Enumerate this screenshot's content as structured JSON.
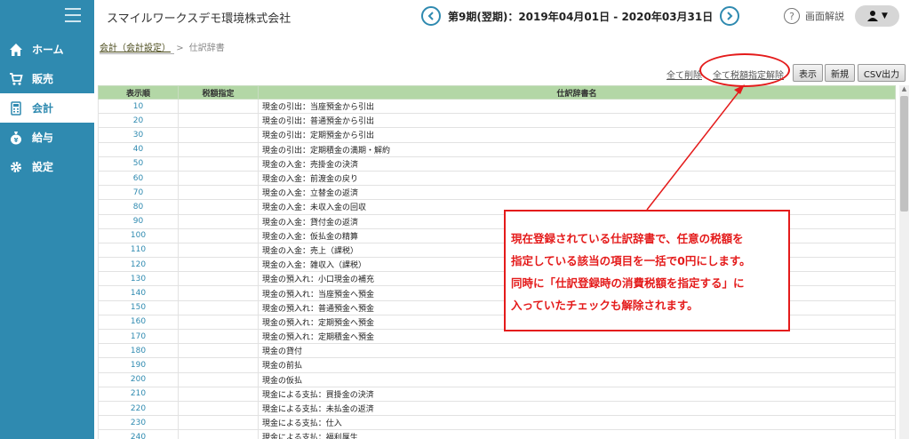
{
  "header": {
    "company": "スマイルワークスデモ環境株式会社",
    "period": "第9期(翌期)：2019年04月01日 - 2020年03月31日",
    "help_label": "画面解説"
  },
  "sidebar": {
    "items": [
      {
        "label": "ホーム",
        "icon": "home-icon"
      },
      {
        "label": "販売",
        "icon": "cart-icon"
      },
      {
        "label": "会計",
        "icon": "calculator-icon"
      },
      {
        "label": "給与",
        "icon": "money-bag-icon"
      },
      {
        "label": "設定",
        "icon": "gear-icon"
      }
    ],
    "active": "会計"
  },
  "breadcrumb": {
    "parent": "会計（会計設定）",
    "separator": ">",
    "current": "仕訳辞書"
  },
  "toolbar": {
    "delete_all": "全て削除",
    "clear_tax": "全て税額指定解除",
    "display": "表示",
    "new": "新規",
    "csv": "CSV出力"
  },
  "table": {
    "headers": [
      "表示順",
      "税額指定",
      "仕訳辞書名"
    ],
    "rows": [
      {
        "order": "10",
        "name": "現金の引出：当座預金から引出"
      },
      {
        "order": "20",
        "name": "現金の引出：普通預金から引出"
      },
      {
        "order": "30",
        "name": "現金の引出：定期預金から引出"
      },
      {
        "order": "40",
        "name": "現金の引出：定期積金の満期・解約"
      },
      {
        "order": "50",
        "name": "現金の入金：売掛金の決済"
      },
      {
        "order": "60",
        "name": "現金の入金：前渡金の戻り"
      },
      {
        "order": "70",
        "name": "現金の入金：立替金の返済"
      },
      {
        "order": "80",
        "name": "現金の入金：未収入金の回収"
      },
      {
        "order": "90",
        "name": "現金の入金：貸付金の返済"
      },
      {
        "order": "100",
        "name": "現金の入金：仮払金の精算"
      },
      {
        "order": "110",
        "name": "現金の入金：売上（課税）"
      },
      {
        "order": "120",
        "name": "現金の入金：雑収入（課税）"
      },
      {
        "order": "130",
        "name": "現金の預入れ：小口現金の補充"
      },
      {
        "order": "140",
        "name": "現金の預入れ：当座預金へ預金"
      },
      {
        "order": "150",
        "name": "現金の預入れ：普通預金へ預金"
      },
      {
        "order": "160",
        "name": "現金の預入れ：定期預金へ預金"
      },
      {
        "order": "170",
        "name": "現金の預入れ：定期積金へ預金"
      },
      {
        "order": "180",
        "name": "現金の貸付"
      },
      {
        "order": "190",
        "name": "現金の前払"
      },
      {
        "order": "200",
        "name": "現金の仮払"
      },
      {
        "order": "210",
        "name": "現金による支払：買掛金の決済"
      },
      {
        "order": "220",
        "name": "現金による支払：未払金の返済"
      },
      {
        "order": "230",
        "name": "現金による支払：仕入"
      },
      {
        "order": "240",
        "name": "現金による支払：福利厚生"
      }
    ]
  },
  "callout": {
    "lines": [
      "現在登録されている仕訳辞書で、任意の税額を",
      "指定している該当の項目を一括で0円にします。",
      "同時に「仕訳登録時の消費税額を指定する」に",
      "入っていたチェックも解除されます。"
    ]
  },
  "colors": {
    "sidebar": "#2f8ab0",
    "header_row": "#b3d7a6",
    "annotation": "#e41b1b"
  }
}
